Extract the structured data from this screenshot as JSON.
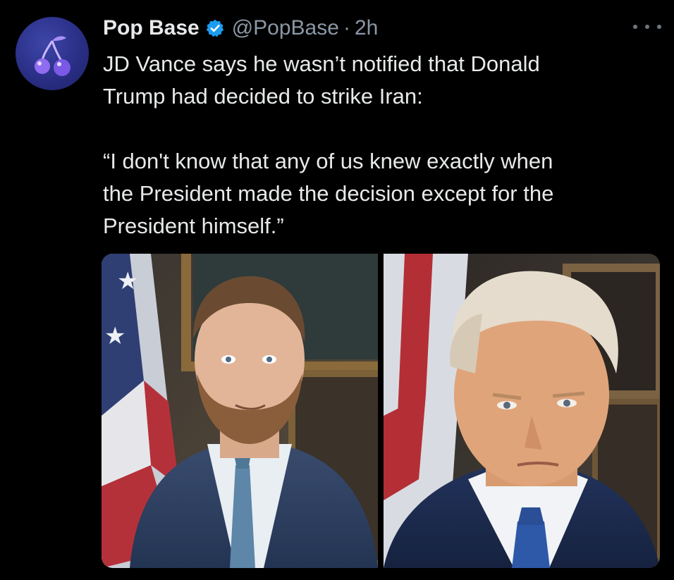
{
  "account": {
    "display_name": "Pop Base",
    "handle": "@PopBase",
    "separator": "·",
    "time": "2h",
    "avatar_icon": "cherries-icon",
    "verified_icon": "verified-badge-icon"
  },
  "tweet": {
    "text": "JD Vance says he wasn’t notified that Donald\nTrump had decided to strike Iran:\n\n“I don't know that any of us knew exactly when\nthe President made the decision except for the\nPresident himself.”"
  },
  "media": {
    "images": [
      {
        "subject": "portrait-left"
      },
      {
        "subject": "portrait-right"
      }
    ]
  },
  "icons": {
    "more": "more-options-icon"
  },
  "colors": {
    "background": "#000000",
    "text": "#e7e9ea",
    "secondary": "#8b98a5",
    "verified": "#1d9bf0"
  }
}
